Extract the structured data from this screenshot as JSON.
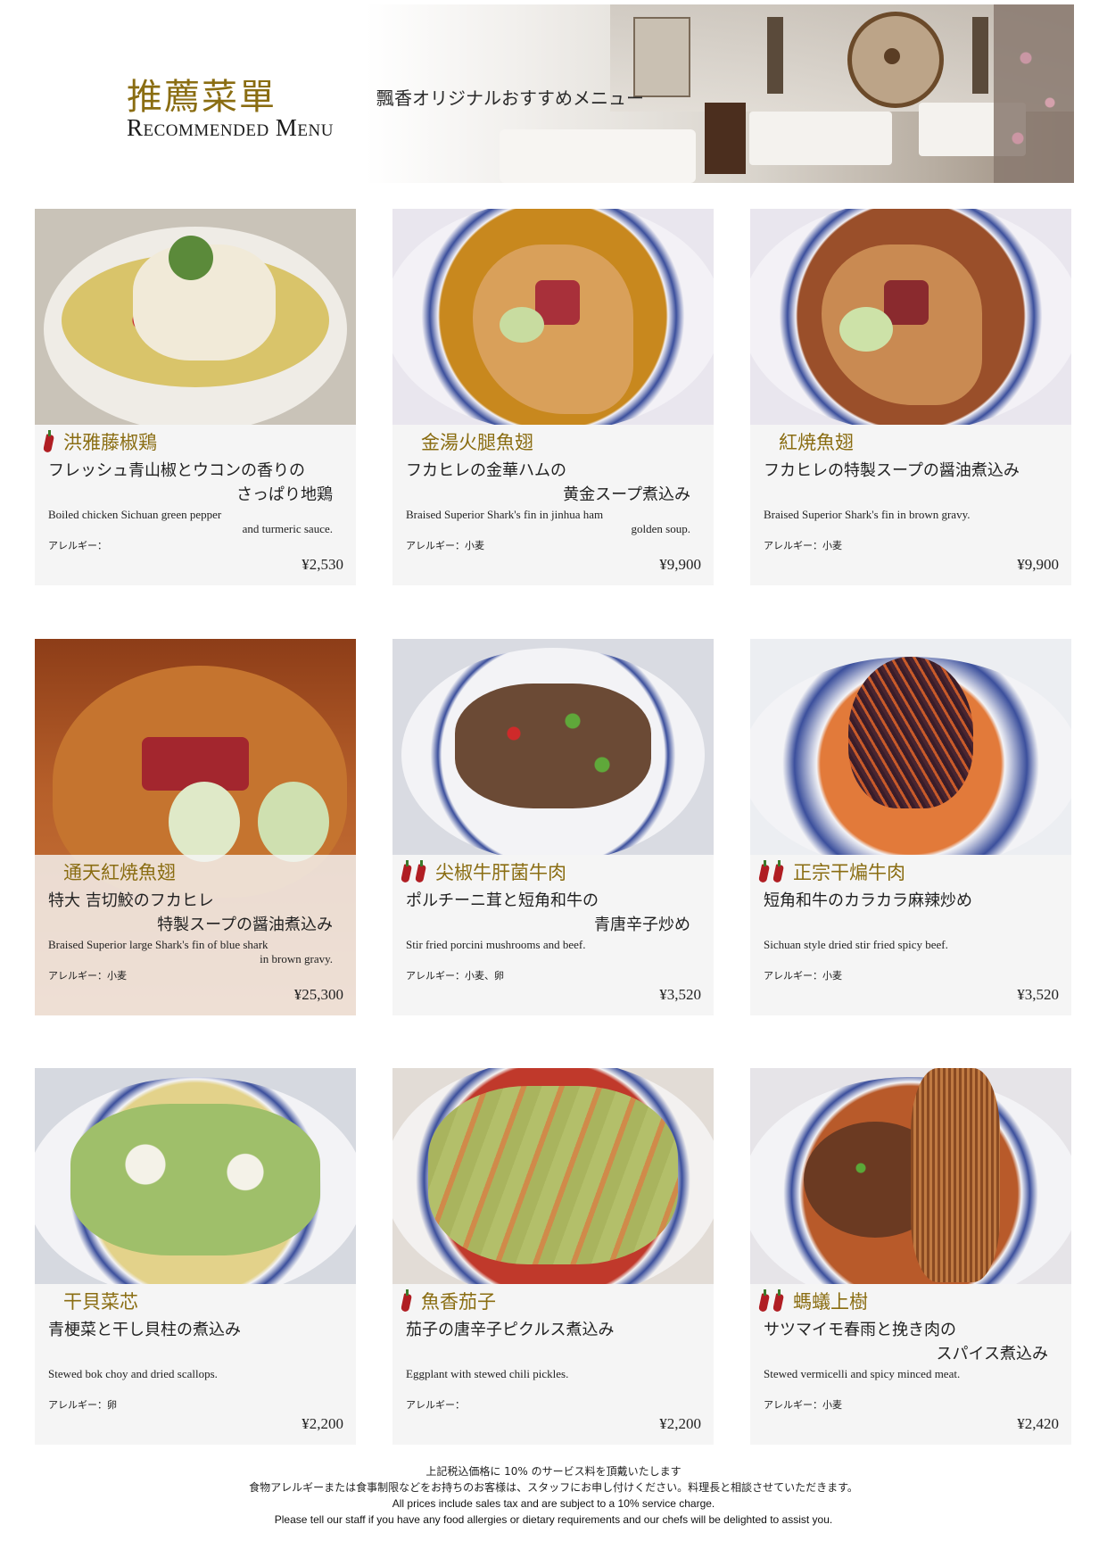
{
  "header": {
    "title_jp": "推薦菜單",
    "title_en": "Recommended Menu",
    "subtitle": "飄香オリジナルおすすめメニュー"
  },
  "items": [
    {
      "spice": 1,
      "name": "洪雅藤椒鶏",
      "jp1": "フレッシュ青山椒とウコンの香りの",
      "jp2": "さっぱり地鶏",
      "en1": "Boiled chicken Sichuan green pepper",
      "en2": "and turmeric sauce.",
      "allergy": "アレルギー：",
      "price": "¥2,530"
    },
    {
      "spice": 0,
      "name": "金湯火腿魚翅",
      "jp1": "フカヒレの金華ハムの",
      "jp2": "黄金スープ煮込み",
      "en1": "Braised Superior Shark's fin in jinhua ham",
      "en2": "golden soup.",
      "allergy": "アレルギー：小麦",
      "price": "¥9,900"
    },
    {
      "spice": 0,
      "name": "紅焼魚翅",
      "jp1": "フカヒレの特製スープの醤油煮込み",
      "jp2": "",
      "en1": "Braised Superior Shark's fin in brown gravy.",
      "en2": "",
      "allergy": "アレルギー：小麦",
      "price": "¥9,900"
    },
    {
      "spice": 0,
      "name": "通天紅焼魚翅",
      "jp1": "特大 吉切鮫のフカヒレ",
      "jp2": "特製スープの醤油煮込み",
      "en1": "Braised Superior large Shark's fin of blue shark",
      "en2": "in brown gravy.",
      "allergy": "アレルギー：小麦",
      "price": "¥25,300"
    },
    {
      "spice": 2,
      "name": "尖椒牛肝菌牛肉",
      "jp1": "ポルチーニ茸と短角和牛の",
      "jp2": "青唐辛子炒め",
      "en1": "Stir fried porcini mushrooms and beef.",
      "en2": "",
      "allergy": "アレルギー：小麦、卵",
      "price": "¥3,520"
    },
    {
      "spice": 2,
      "name": "正宗干煸牛肉",
      "jp1": "短角和牛のカラカラ麻辣炒め",
      "jp2": "",
      "en1": "Sichuan style dried stir fried spicy beef.",
      "en2": "",
      "allergy": "アレルギー：小麦",
      "price": "¥3,520"
    },
    {
      "spice": 0,
      "name": "干貝菜芯",
      "jp1": "青梗菜と干し貝柱の煮込み",
      "jp2": "",
      "en1": "Stewed bok choy and dried scallops.",
      "en2": "",
      "allergy": "アレルギー：卵",
      "price": "¥2,200"
    },
    {
      "spice": 1,
      "name": "魚香茄子",
      "jp1": "茄子の唐辛子ピクルス煮込み",
      "jp2": "",
      "en1": "Eggplant with stewed chili pickles.",
      "en2": "",
      "allergy": "アレルギー：",
      "price": "¥2,200"
    },
    {
      "spice": 2,
      "name": "螞蟻上樹",
      "jp1": "サツマイモ春雨と挽き肉の",
      "jp2": "スパイス煮込み",
      "en1": "Stewed vermicelli and spicy minced meat.",
      "en2": "",
      "allergy": "アレルギー：小麦",
      "price": "¥2,420"
    }
  ],
  "footer": {
    "line1": "上記税込価格に 10% のサービス料を頂戴いたします",
    "line2": "食物アレルギーまたは食事制限などをお持ちのお客様は、スタッフにお申し付けください。料理長と相談させていただきます。",
    "line3": "All prices include sales tax and are subject to a 10% service charge.",
    "line4": "Please tell our staff if you have any food allergies or dietary requirements and our chefs will be delighted to assist you."
  },
  "colors": {
    "name": "#8a6d12",
    "card_bg": "#f5f5f5",
    "pepper": "#b01e23"
  }
}
